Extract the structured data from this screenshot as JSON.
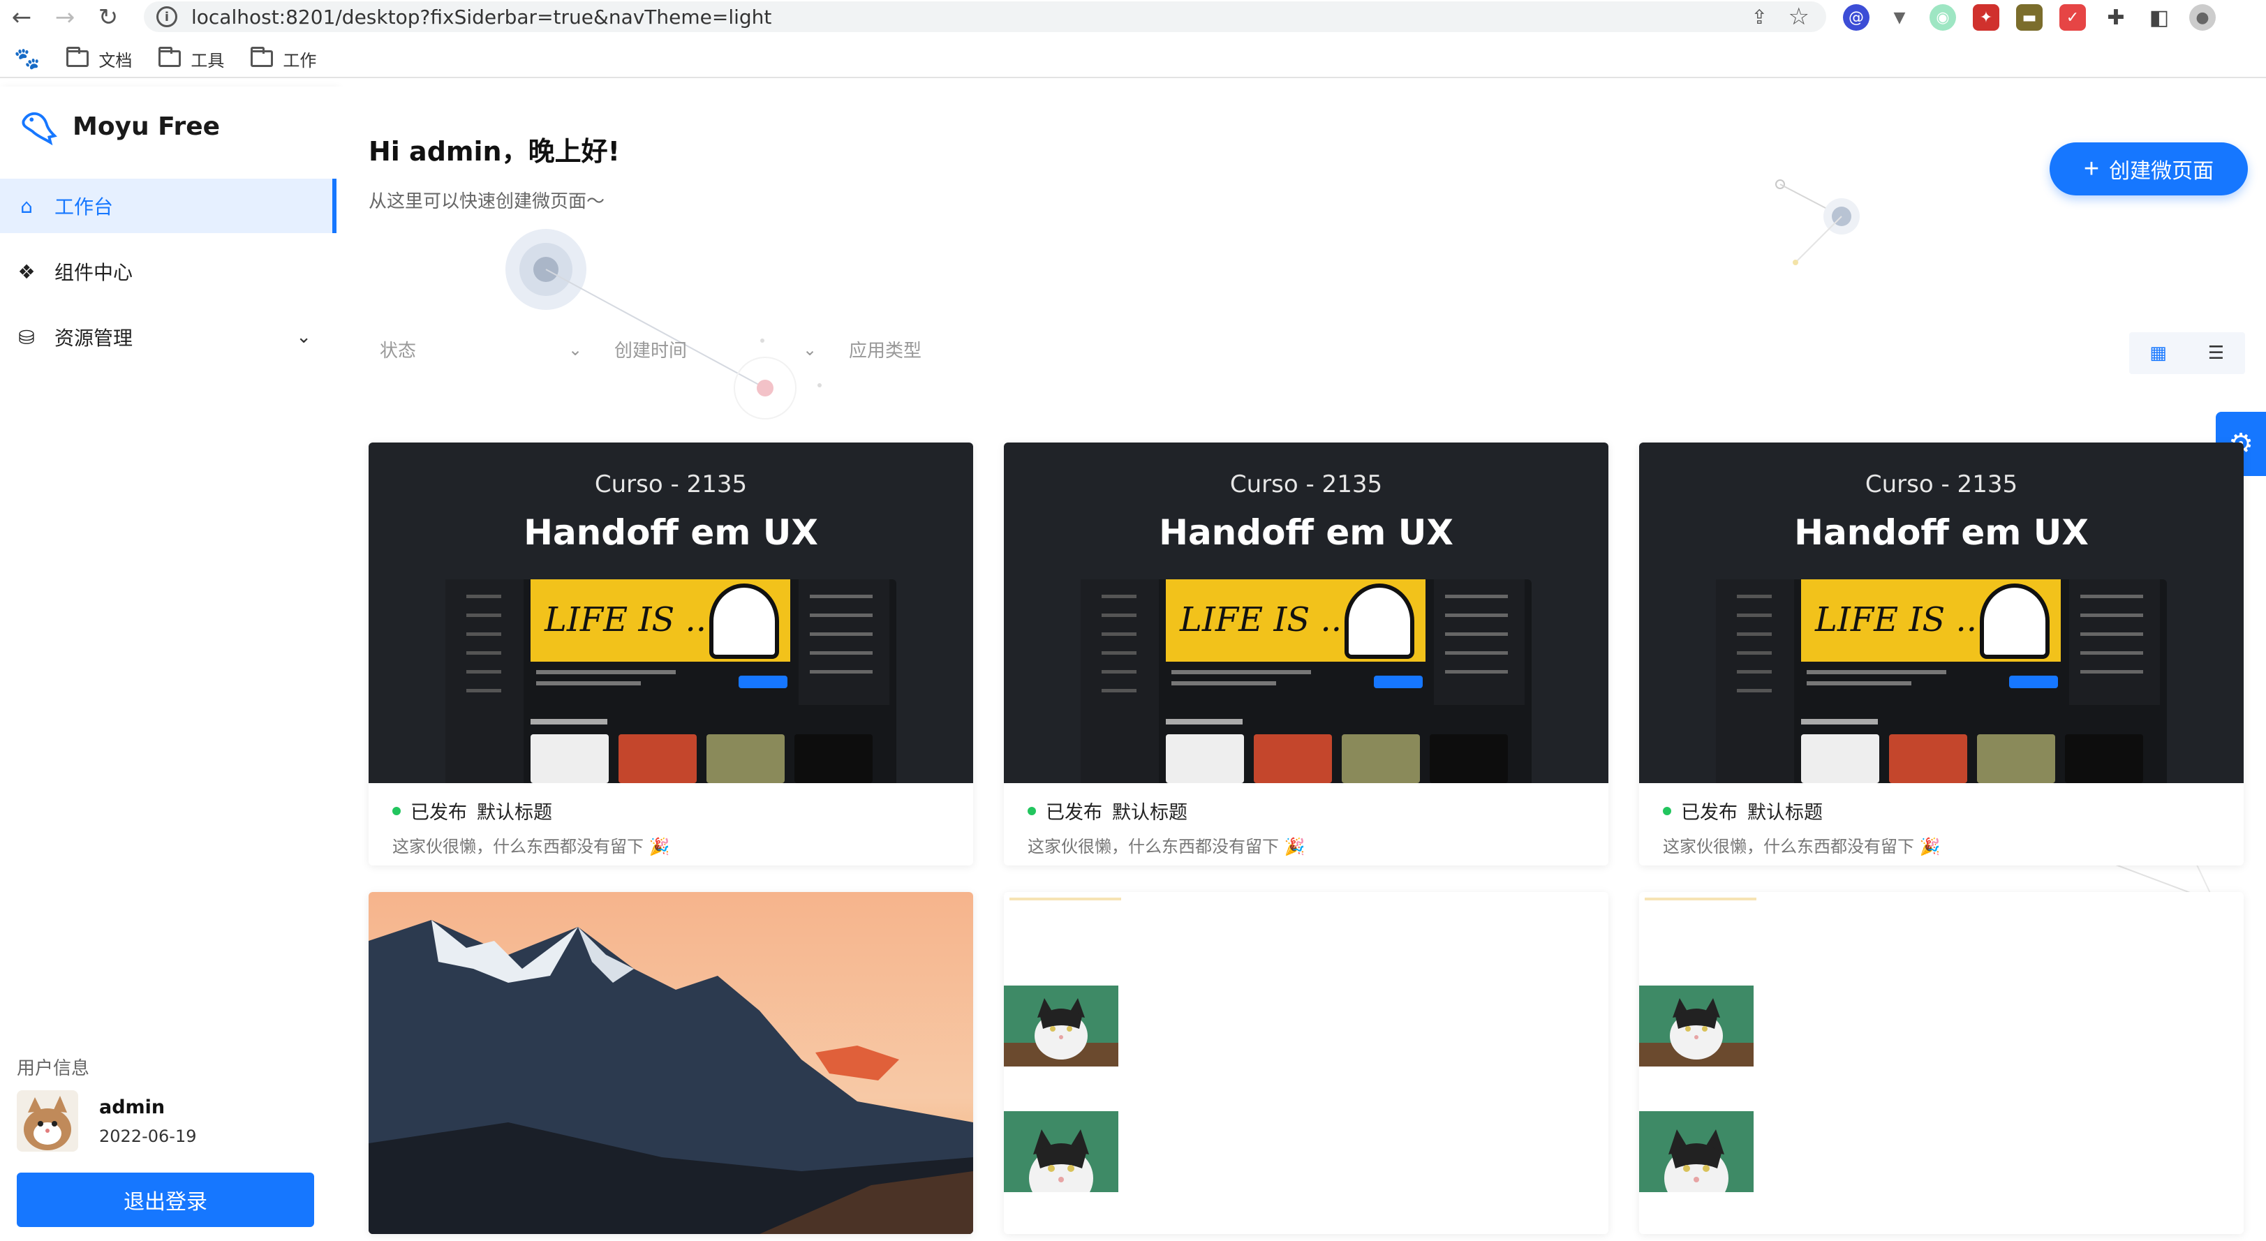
{
  "browser": {
    "url": "localhost:8201/desktop?fixSiderbar=true&navTheme=light",
    "bookmarks": [
      "文档",
      "工具",
      "工作"
    ]
  },
  "brand": {
    "name": "Moyu Free"
  },
  "menu": [
    {
      "label": "工作台",
      "icon": "home-icon",
      "active": true
    },
    {
      "label": "组件中心",
      "icon": "apps-icon",
      "active": false
    },
    {
      "label": "资源管理",
      "icon": "database-icon",
      "active": false,
      "expandable": true
    }
  ],
  "user": {
    "section_title": "用户信息",
    "name": "admin",
    "date": "2022-06-19",
    "logout_label": "退出登录"
  },
  "header": {
    "greeting": "Hi admin，晚上好!",
    "subtitle": "从这里可以快速创建微页面～",
    "create_label": "创建微页面"
  },
  "filters": [
    {
      "label": "状态"
    },
    {
      "label": "创建时间"
    },
    {
      "label": "应用类型"
    }
  ],
  "cards": [
    {
      "course": "Curso - 2135",
      "title": "Handoff em UX",
      "mini_text": "LIFE IS ...",
      "status": "已发布",
      "name": "默认标题",
      "desc": "这家伙很懒，什么东西都没有留下 🎉"
    },
    {
      "course": "Curso - 2135",
      "title": "Handoff em UX",
      "mini_text": "LIFE IS ...",
      "status": "已发布",
      "name": "默认标题",
      "desc": "这家伙很懒，什么东西都没有留下 🎉"
    },
    {
      "course": "Curso - 2135",
      "title": "Handoff em UX",
      "mini_text": "LIFE IS ...",
      "status": "已发布",
      "name": "默认标题",
      "desc": "这家伙很懒，什么东西都没有留下 🎉"
    }
  ],
  "colors": {
    "primary": "#1677ff",
    "published": "#22c55e"
  }
}
